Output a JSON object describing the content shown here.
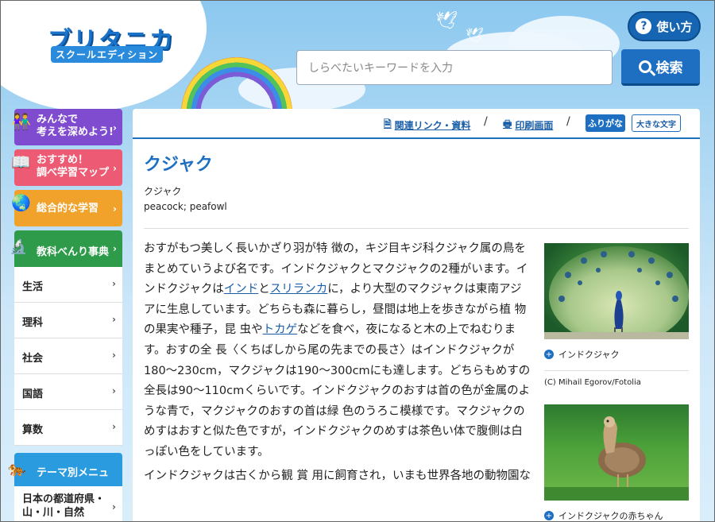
{
  "header": {
    "logo_main": "ブリタニカ",
    "logo_sub": "スクールエディション",
    "help_label": "使い方",
    "search_placeholder": "しらべたいキーワードを入力",
    "search_button": "検索"
  },
  "sidebar": {
    "feature_buttons": [
      {
        "line1": "みんなで",
        "line2": "考えを深めよう!",
        "color": "#7f4bcf"
      },
      {
        "line1": "おすすめ！",
        "line2": "調べ学習マップ",
        "color": "#ec5b73"
      },
      {
        "line1": "総合的な学習",
        "line2": "",
        "color": "#f0a22a"
      }
    ],
    "dictionary_title": "教科べんり事典",
    "subjects": [
      "生活",
      "理科",
      "社会",
      "国語",
      "算数"
    ],
    "theme_title": "テーマ別メニュー",
    "theme_item_line1": "日本の都道府県・",
    "theme_item_line2": "山・川・自然"
  },
  "toolbar": {
    "related_links": "関連リンク・資料",
    "print": "印刷画面",
    "furigana": "ふりがな",
    "large_text": "大きな文字"
  },
  "article": {
    "title": "クジャク",
    "subtitle_ja": "クジャク",
    "subtitle_en": "peacock; peafowl",
    "body": {
      "s1": "おすがもつ美しく長いかざり羽が特 徴の，キジ目キジ科クジャク属の鳥をまとめていうよび名です。インドクジャクとマクジャクの2種がいます。インドクジャクは",
      "link_india": "インド",
      "to": "と",
      "link_srilanka": "スリランカ",
      "s2": "に，より大型のマクジャクは東南アジアに生息しています。どちらも森に暮らし，昼間は地上を歩きながら植 物の果実や種子，昆 虫や",
      "link_lizard": "トカゲ",
      "s3": "などを食べ，夜になると木の上でねむります。おすの全 長〈くちばしから尾の先までの長さ〉はインドクジャクが180〜230cm，マクジャクは190〜300cmにも達します。どちらもめすの全長は90〜110cmくらいです。インドクジャクのおすは首の色が金属のような青で，マクジャクのおすの首は緑 色のうろこ模様です。マクジャクのめすはおすと似た色ですが，インドクジャクのめすは茶色い体で腹側は白っぽい色をしています。",
      "s4": "インドクジャクは古くから観 賞 用に飼育され，いまも世界各地の動物園な"
    }
  },
  "images": {
    "caption1": "インドクジャク",
    "credit": "(C) Mihail Egorov/Fotolia",
    "caption2": "インドクジャクの赤ちゃん"
  }
}
